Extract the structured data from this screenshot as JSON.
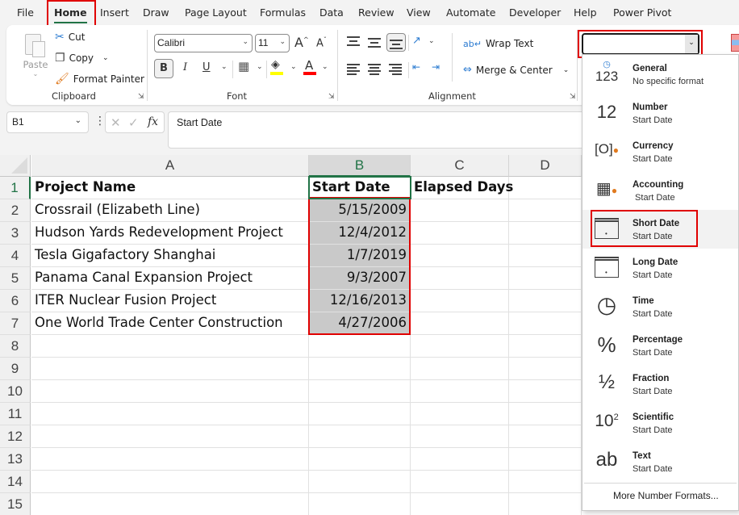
{
  "menu_tabs": [
    {
      "label": "File"
    },
    {
      "label": "Home",
      "active": true
    },
    {
      "label": "Insert"
    },
    {
      "label": "Draw"
    },
    {
      "label": "Page Layout"
    },
    {
      "label": "Formulas"
    },
    {
      "label": "Data"
    },
    {
      "label": "Review"
    },
    {
      "label": "View"
    },
    {
      "label": "Automate"
    },
    {
      "label": "Developer"
    },
    {
      "label": "Help"
    },
    {
      "label": "Power Pivot"
    }
  ],
  "ribbon": {
    "clipboard": {
      "paste_label": "Paste",
      "cut_label": "Cut",
      "copy_label": "Copy",
      "format_painter_label": "Format Painter",
      "group_label": "Clipboard"
    },
    "font": {
      "font_name": "Calibri",
      "font_size": "11",
      "bold": "B",
      "italic": "I",
      "underline": "U",
      "group_label": "Font",
      "fill_color": "#ffff00",
      "font_color": "#ff0000"
    },
    "alignment": {
      "wrap_text_label": "Wrap Text",
      "merge_center_label": "Merge & Center",
      "group_label": "Alignment"
    },
    "number": {
      "format_value": ""
    }
  },
  "formula_bar": {
    "name_box": "B1",
    "formula": "Start Date"
  },
  "sheet": {
    "columns": [
      "A",
      "B",
      "C",
      "D"
    ],
    "selected_column": "B",
    "rows": [
      {
        "n": "1",
        "cells": [
          "Project Name",
          "Start Date",
          "Elapsed Days",
          ""
        ]
      },
      {
        "n": "2",
        "cells": [
          "Crossrail (Elizabeth Line)",
          "5/15/2009",
          "",
          ""
        ]
      },
      {
        "n": "3",
        "cells": [
          "Hudson Yards Redevelopment Project",
          "12/4/2012",
          "",
          ""
        ]
      },
      {
        "n": "4",
        "cells": [
          "Tesla Gigafactory Shanghai",
          "1/7/2019",
          "",
          ""
        ]
      },
      {
        "n": "5",
        "cells": [
          "Panama Canal Expansion Project",
          "9/3/2007",
          "",
          ""
        ]
      },
      {
        "n": "6",
        "cells": [
          "ITER Nuclear Fusion Project",
          "12/16/2013",
          "",
          ""
        ]
      },
      {
        "n": "7",
        "cells": [
          "One World Trade Center Construction",
          "4/27/2006",
          "",
          ""
        ]
      },
      {
        "n": "8",
        "cells": [
          "",
          "",
          "",
          ""
        ]
      },
      {
        "n": "9",
        "cells": [
          "",
          "",
          "",
          ""
        ]
      },
      {
        "n": "10",
        "cells": [
          "",
          "",
          "",
          ""
        ]
      },
      {
        "n": "11",
        "cells": [
          "",
          "",
          "",
          ""
        ]
      },
      {
        "n": "12",
        "cells": [
          "",
          "",
          "",
          ""
        ]
      },
      {
        "n": "13",
        "cells": [
          "",
          "",
          "",
          ""
        ]
      },
      {
        "n": "14",
        "cells": [
          "",
          "",
          "",
          ""
        ]
      },
      {
        "n": "15",
        "cells": [
          "",
          "",
          "",
          ""
        ]
      }
    ]
  },
  "number_format_dropdown": {
    "items": [
      {
        "title": "General",
        "subtitle": "No specific format",
        "icon": "clock-123-icon"
      },
      {
        "title": "Number",
        "subtitle": "Start Date",
        "icon": "number-12-icon"
      },
      {
        "title": "Currency",
        "subtitle": "Start Date",
        "icon": "currency-icon"
      },
      {
        "title": "Accounting",
        "subtitle": " Start Date",
        "icon": "accounting-icon"
      },
      {
        "title": "Short Date",
        "subtitle": "Start Date",
        "icon": "calendar-icon",
        "highlighted": true
      },
      {
        "title": "Long Date",
        "subtitle": "Start Date",
        "icon": "calendar-icon"
      },
      {
        "title": "Time",
        "subtitle": "Start Date",
        "icon": "clock-icon"
      },
      {
        "title": "Percentage",
        "subtitle": "Start Date",
        "icon": "percent-icon"
      },
      {
        "title": "Fraction",
        "subtitle": "Start Date",
        "icon": "fraction-icon"
      },
      {
        "title": "Scientific",
        "subtitle": "Start Date",
        "icon": "scientific-icon"
      },
      {
        "title": "Text",
        "subtitle": "Start Date",
        "icon": "text-ab-icon"
      }
    ],
    "more_label": "More Number Formats..."
  },
  "colors": {
    "highlight_red": "#e00000",
    "excel_green": "#217346",
    "selected_fill": "#c9c9c9"
  }
}
